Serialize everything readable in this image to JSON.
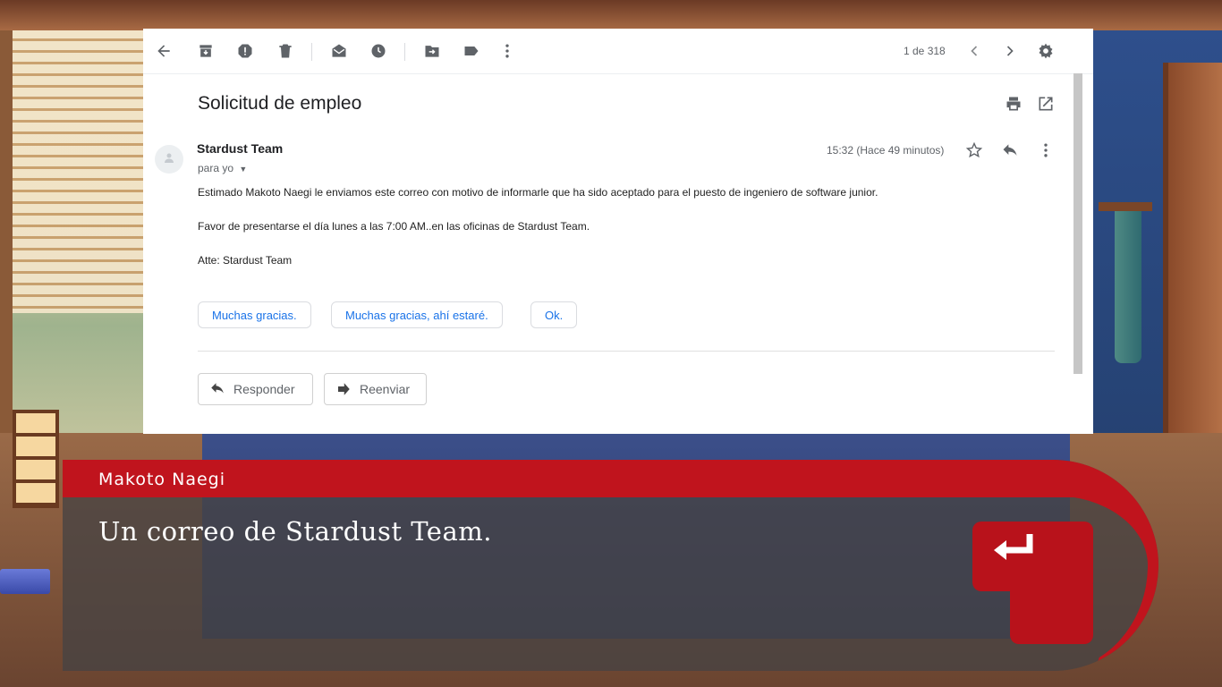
{
  "toolbar": {
    "icons": [
      "back-arrow-icon",
      "archive-icon",
      "report-spam-icon",
      "delete-icon",
      "mark-unread-icon",
      "snooze-icon",
      "move-to-icon",
      "label-icon",
      "more-vert-icon"
    ],
    "counter": "1 de 318"
  },
  "email": {
    "subject": "Solicitud de empleo",
    "sender": "Stardust Team",
    "recipient": "para yo",
    "timestamp": "15:32 (Hace 49 minutos)",
    "body": [
      "Estimado Makoto Naegi le enviamos este correo con motivo de informarle que ha sido aceptado para el puesto de ingeniero de software junior.",
      "Favor de presentarse el día lunes a las 7:00 AM..en las oficinas de Stardust Team.",
      "Atte: Stardust Team"
    ],
    "smart_replies": [
      "Muchas gracias.",
      "Muchas gracias, ahí estaré.",
      "Ok."
    ],
    "reply_label": "Responder",
    "forward_label": "Reenviar"
  },
  "dialogue": {
    "speaker": "Makoto Naegi",
    "text": "Un correo de Stardust Team."
  },
  "colors": {
    "accent_red": "#c0141d",
    "link_blue": "#1a73e8"
  }
}
